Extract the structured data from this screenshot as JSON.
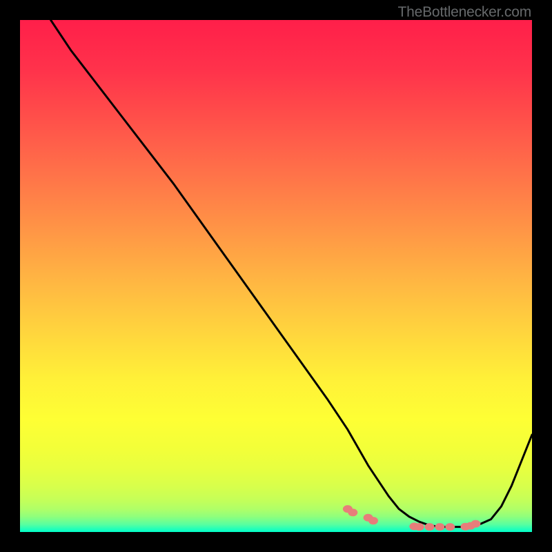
{
  "attribution": "TheBottlenecker.com",
  "chart_data": {
    "type": "line",
    "title": "",
    "xlabel": "",
    "ylabel": "",
    "xlim": [
      0,
      100
    ],
    "ylim": [
      0,
      100
    ],
    "series": [
      {
        "name": "curve",
        "x": [
          6,
          10,
          15,
          20,
          25,
          30,
          35,
          40,
          45,
          50,
          55,
          60,
          64,
          68,
          70,
          72,
          74,
          76,
          78,
          80,
          82,
          84,
          86,
          88,
          90,
          92,
          94,
          96,
          98,
          100
        ],
        "y": [
          100,
          94,
          87.5,
          81,
          74.5,
          68,
          61,
          54,
          47,
          40,
          33,
          26,
          20,
          13,
          10,
          7,
          4.5,
          3,
          2,
          1.3,
          1,
          1,
          1,
          1.2,
          1.6,
          2.5,
          5,
          9,
          14,
          19
        ]
      },
      {
        "name": "markers",
        "x": [
          64,
          65,
          68,
          69,
          77,
          78,
          80,
          82,
          84,
          87,
          88,
          89
        ],
        "y": [
          4.5,
          3.8,
          2.8,
          2.2,
          1.1,
          1.0,
          1.0,
          1.0,
          1.0,
          1.05,
          1.2,
          1.6
        ]
      }
    ],
    "gradient_stops": [
      {
        "offset": 0.0,
        "color": "#ff1f4a"
      },
      {
        "offset": 0.1,
        "color": "#ff334b"
      },
      {
        "offset": 0.2,
        "color": "#ff524a"
      },
      {
        "offset": 0.3,
        "color": "#ff7249"
      },
      {
        "offset": 0.4,
        "color": "#ff9246"
      },
      {
        "offset": 0.5,
        "color": "#ffb343"
      },
      {
        "offset": 0.6,
        "color": "#ffd23e"
      },
      {
        "offset": 0.7,
        "color": "#fff038"
      },
      {
        "offset": 0.78,
        "color": "#feff34"
      },
      {
        "offset": 0.84,
        "color": "#f2ff39"
      },
      {
        "offset": 0.88,
        "color": "#e6ff41"
      },
      {
        "offset": 0.91,
        "color": "#d8ff4b"
      },
      {
        "offset": 0.935,
        "color": "#c7ff57"
      },
      {
        "offset": 0.955,
        "color": "#b0ff67"
      },
      {
        "offset": 0.97,
        "color": "#8fff7d"
      },
      {
        "offset": 0.985,
        "color": "#5aff9f"
      },
      {
        "offset": 1.0,
        "color": "#00ffca"
      }
    ],
    "marker_color": "#e77d7a",
    "curve_color": "#000000"
  }
}
